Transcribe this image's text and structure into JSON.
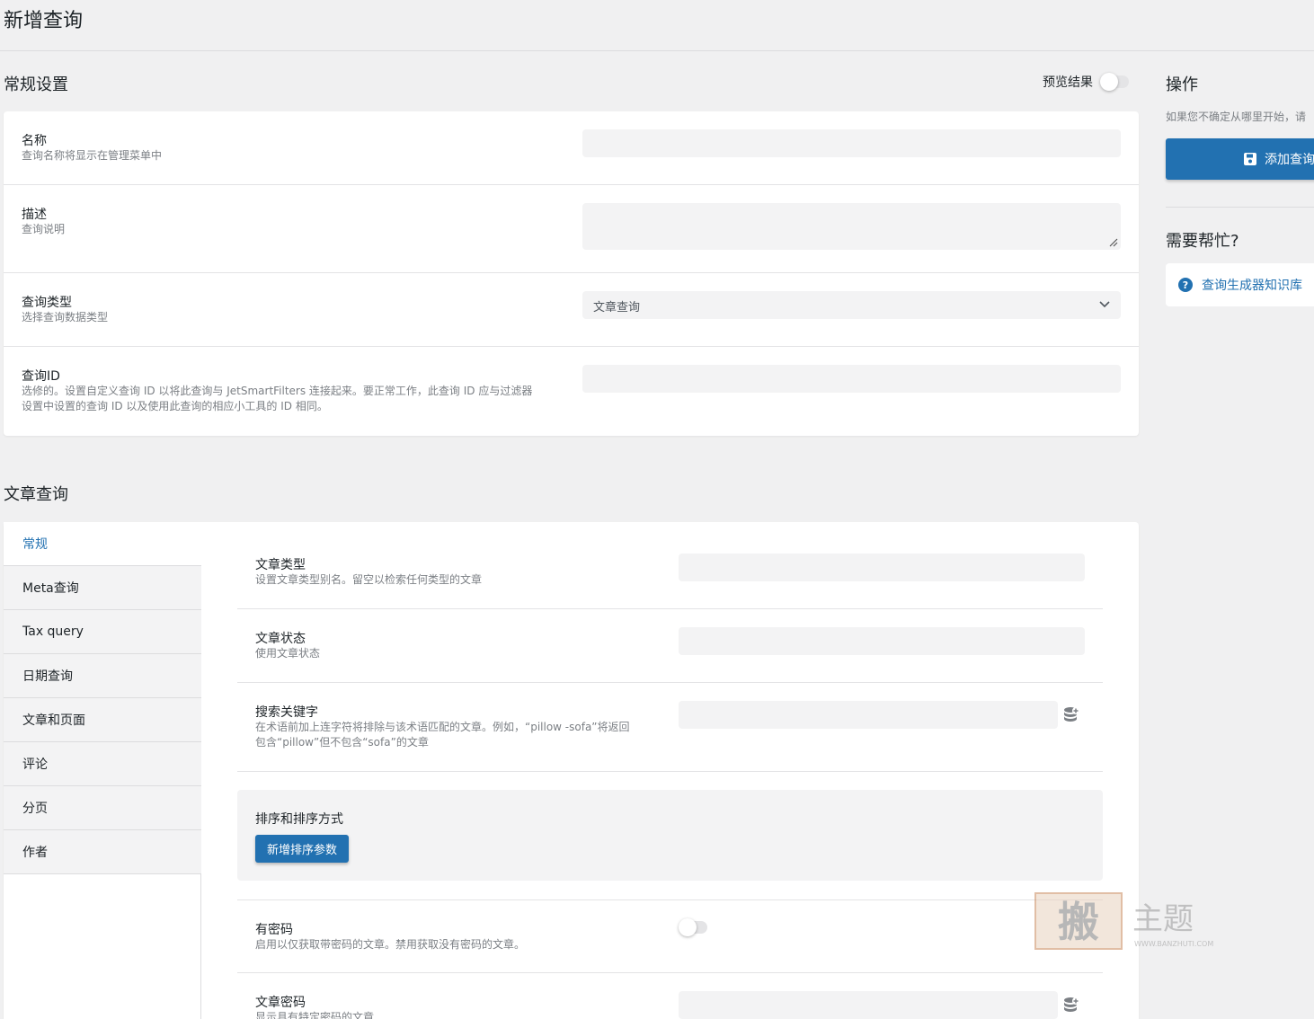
{
  "page": {
    "title": "新增查询"
  },
  "general": {
    "title": "常规设置",
    "preview_label": "预览结果",
    "fields": [
      {
        "label": "名称",
        "desc": "查询名称将显示在管理菜单中",
        "value": ""
      },
      {
        "label": "描述",
        "desc": "查询说明",
        "value": ""
      },
      {
        "label": "查询类型",
        "desc": "选择查询数据类型",
        "value": "文章查询"
      },
      {
        "label": "查询ID",
        "desc_line1": "选修的。设置自定义查询 ID 以将此查询与 JetSmartFilters 连接起来。要正常工作，此查询 ID 应与过滤器",
        "desc_line2": "设置中设置的查询 ID 以及使用此查询的相应小工具的 ID 相同。",
        "value": ""
      }
    ]
  },
  "sidebar": {
    "actions_title": "操作",
    "actions_note": "如果您不确定从哪里开始，请",
    "add_button": "添加查询",
    "help_title": "需要帮忙?",
    "help_link": "查询生成器知识库"
  },
  "post_query": {
    "title": "文章查询",
    "tabs": [
      "常规",
      "Meta查询",
      "Tax query",
      "日期查询",
      "文章和页面",
      "评论",
      "分页",
      "作者"
    ],
    "fields": [
      {
        "label": "文章类型",
        "desc": "设置文章类型别名。留空以检索任何类型的文章"
      },
      {
        "label": "文章状态",
        "desc": "使用文章状态"
      },
      {
        "label": "搜索关键字",
        "desc_line1": "在术语前加上连字符将排除与该术语匹配的文章。例如，“pillow -sofa”将返回",
        "desc_line2": "包含“pillow”但不包含“sofa”的文章"
      },
      {
        "label": "有密码",
        "desc": "启用以仅获取带密码的文章。禁用获取没有密码的文章。"
      },
      {
        "label": "文章密码",
        "desc": "显示具有特定密码的文章"
      }
    ],
    "sort": {
      "title": "排序和排序方式",
      "button": "新增排序参数"
    }
  },
  "watermark": {
    "text": "主题",
    "url": "WWW.BANZHUTI.COM"
  },
  "colors": {
    "accent": "#2271b1",
    "background": "#f0f0f1"
  }
}
